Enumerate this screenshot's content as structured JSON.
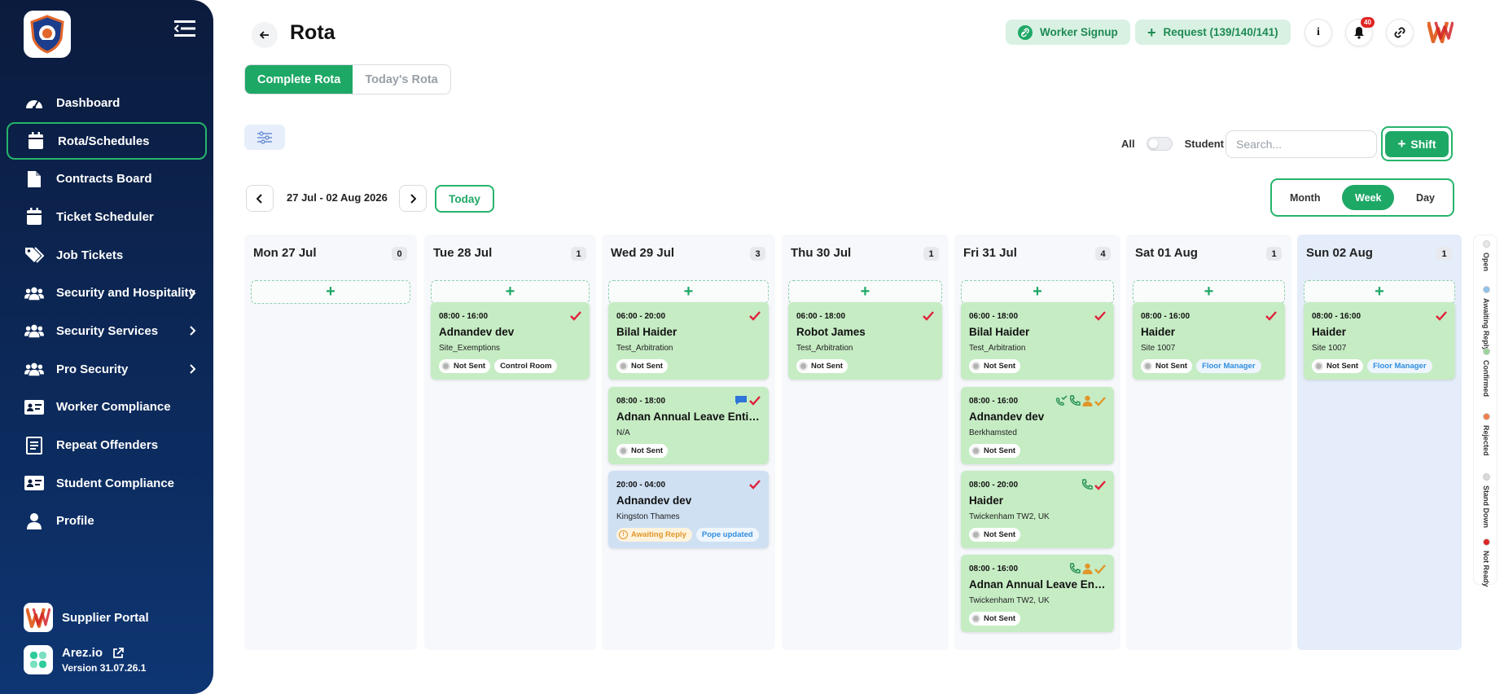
{
  "sidebar": {
    "items": [
      {
        "label": "Dashboard",
        "icon": "dashboard-gauge-icon"
      },
      {
        "label": "Rota/Schedules",
        "icon": "calendar-icon",
        "active": true
      },
      {
        "label": "Contracts Board",
        "icon": "document-icon"
      },
      {
        "label": "Ticket Scheduler",
        "icon": "calendar-icon"
      },
      {
        "label": "Job Tickets",
        "icon": "tags-icon"
      },
      {
        "label": "Security and Hospitality",
        "icon": "users-icon",
        "has_submenu": true
      },
      {
        "label": "Security Services",
        "icon": "users-icon",
        "has_submenu": true
      },
      {
        "label": "Pro Security",
        "icon": "users-icon",
        "has_submenu": true
      },
      {
        "label": "Worker Compliance",
        "icon": "id-card-icon"
      },
      {
        "label": "Repeat Offenders",
        "icon": "list-document-icon"
      },
      {
        "label": "Student Compliance",
        "icon": "id-card-icon"
      },
      {
        "label": "Profile",
        "icon": "user-icon"
      }
    ],
    "supplier_portal": "Supplier Portal",
    "arez_name": "Arez.io",
    "version": "Version 31.07.26.1"
  },
  "header": {
    "title": "Rota",
    "worker_signup": "Worker Signup",
    "request": "Request (139/140/141)",
    "notification_count": "40"
  },
  "tabs": [
    "Complete Rota",
    "Today's Rota"
  ],
  "filters": {
    "toggle_left": "All",
    "toggle_right": "Student",
    "search_placeholder": "Search...",
    "shift_button": "Shift"
  },
  "date_nav": {
    "range": "27 Jul - 02 Aug 2026",
    "today": "Today"
  },
  "views": [
    "Month",
    "Week",
    "Day"
  ],
  "active_view": "Week",
  "days": [
    {
      "label": "Mon 27 Jul",
      "count": "0",
      "shifts": []
    },
    {
      "label": "Tue 28 Jul",
      "count": "1",
      "shifts": [
        {
          "time": "08:00 - 16:00",
          "name": "Adnandev dev",
          "site": "Site_Exemptions",
          "status": "Not Sent",
          "extra": "Control Room",
          "extra_type": "plain",
          "icons": [
            "check-icon"
          ]
        }
      ]
    },
    {
      "label": "Wed 29 Jul",
      "count": "3",
      "shifts": [
        {
          "time": "06:00 - 20:00",
          "name": "Bilal Haider",
          "site": "Test_Arbitration",
          "status": "Not Sent",
          "icons": [
            "check-icon"
          ]
        },
        {
          "time": "08:00 - 18:00",
          "name": "Adnan Annual Leave Entitlement",
          "site": "N/A",
          "status": "Not Sent",
          "icons": [
            "message-icon",
            "check-icon"
          ]
        },
        {
          "time": "20:00 - 04:00",
          "name": "Adnandev dev",
          "site": "Kingston Thames",
          "status": "Awaiting Reply",
          "status_type": "await",
          "extra": "Pope updated",
          "extra_type": "pope",
          "color": "blue",
          "icons": [
            "check-icon"
          ]
        }
      ]
    },
    {
      "label": "Thu 30 Jul",
      "count": "1",
      "shifts": [
        {
          "time": "06:00 - 18:00",
          "name": "Robot James",
          "site": "Test_Arbitration",
          "status": "Not Sent",
          "icons": [
            "check-icon"
          ]
        }
      ]
    },
    {
      "label": "Fri 31 Jul",
      "count": "4",
      "shifts": [
        {
          "time": "06:00 - 18:00",
          "name": "Bilal Haider",
          "site": "Test_Arbitration",
          "status": "Not Sent",
          "icons": [
            "check-icon"
          ]
        },
        {
          "time": "08:00 - 16:00",
          "name": "Adnandev dev",
          "site": "Berkhamsted",
          "status": "Not Sent",
          "icons": [
            "phone-check-icon",
            "phone-icon",
            "user-icon",
            "check-icon-orange"
          ]
        },
        {
          "time": "08:00 - 20:00",
          "name": "Haider",
          "site": "Twickenham TW2, UK",
          "status": "Not Sent",
          "icons": [
            "phone-icon",
            "check-icon"
          ]
        },
        {
          "time": "08:00 - 16:00",
          "name": "Adnan Annual Leave Entitlement",
          "site": "Twickenham TW2, UK",
          "status": "Not Sent",
          "icons": [
            "phone-icon",
            "user-icon",
            "check-icon-orange"
          ]
        }
      ]
    },
    {
      "label": "Sat 01 Aug",
      "count": "1",
      "shifts": [
        {
          "time": "08:00 - 16:00",
          "name": "Haider",
          "site": "Site 1007",
          "status": "Not Sent",
          "extra": "Floor Manager",
          "extra_type": "role",
          "icons": [
            "check-icon"
          ]
        }
      ]
    },
    {
      "label": "Sun 02 Aug",
      "count": "1",
      "shifts": [
        {
          "time": "08:00 - 16:00",
          "name": "Haider",
          "site": "Site 1007",
          "status": "Not Sent",
          "extra": "Floor Manager",
          "extra_type": "role",
          "icons": [
            "check-icon"
          ]
        }
      ]
    }
  ],
  "legend": [
    {
      "label": "Open",
      "color": "#e8e8e8"
    },
    {
      "label": "Awaiting Reply",
      "color": "#8fc1ea"
    },
    {
      "label": "Confirmed",
      "color": "#9bd59a"
    },
    {
      "label": "Rejected",
      "color": "#f07d4a"
    },
    {
      "label": "Stand Down",
      "color": "#d9d9d9"
    },
    {
      "label": "Not Ready",
      "color": "#e02424"
    }
  ],
  "colors": {
    "sidebar_bg": "#0b1b3d",
    "accent": "#1ea866",
    "card_green": "#c6ecc4",
    "card_blue": "#cfe0f3",
    "check_red": "#e0213b"
  }
}
